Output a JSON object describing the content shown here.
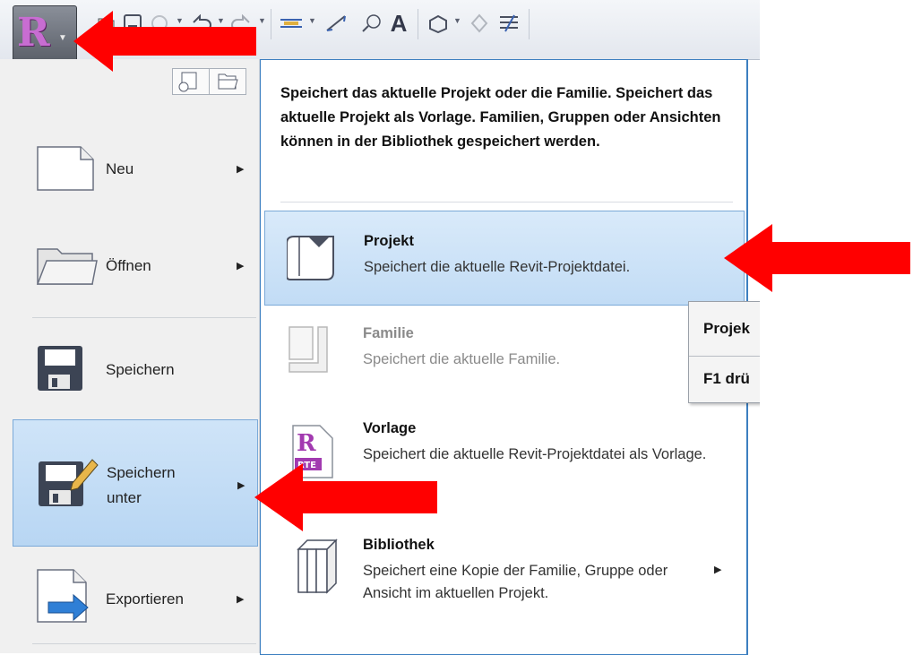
{
  "app": {
    "button_letter": "A",
    "logo_letter": "R"
  },
  "toolbar": {
    "icons": [
      "folder-open-icon",
      "save-icon",
      "sync-icon",
      "undo-icon",
      "redo-icon",
      "measure-icon",
      "dimension-icon",
      "tag-icon",
      "text-icon",
      "3d-view-icon",
      "section-icon",
      "thin-lines-icon"
    ]
  },
  "left_menu": {
    "items": [
      {
        "label": "Neu",
        "icon": "new-document-icon",
        "has_submenu": true
      },
      {
        "label": "Öffnen",
        "icon": "open-folder-icon",
        "has_submenu": true
      },
      {
        "label": "Speichern",
        "icon": "floppy-disk-icon",
        "has_submenu": false
      },
      {
        "label_line1": "Speichern",
        "label_line2": "unter",
        "icon": "save-as-icon",
        "has_submenu": true,
        "highlighted": true
      },
      {
        "label": "Exportieren",
        "icon": "export-icon",
        "has_submenu": true
      }
    ]
  },
  "panel": {
    "description": "Speichert das aktuelle Projekt oder die Familie. Speichert das aktuelle Projekt als Vorlage. Familien, Gruppen oder Ansichten können in der Bibliothek gespeichert werden.",
    "options": [
      {
        "title": "Projekt",
        "text": "Speichert die aktuelle Revit-Projektdatei.",
        "highlighted": true
      },
      {
        "title": "Familie",
        "text": "Speichert die aktuelle Familie.",
        "disabled": true
      },
      {
        "title": "Vorlage",
        "text": "Speichert die aktuelle Revit-Projektdatei als Vorlage.",
        "icon_badge": "RTE"
      },
      {
        "title": "Bibliothek",
        "text": "Speichert eine Kopie der Familie, Gruppe oder Ansicht im aktuellen Projekt.",
        "has_submenu": true
      }
    ]
  },
  "tooltip": {
    "title": "Projek",
    "hint": "F1 drü"
  },
  "colors": {
    "highlight": "#c2dcf5",
    "panel_border": "#3c7fc0",
    "annotation": "#ff0000",
    "app_logo": "#c86dd2"
  }
}
